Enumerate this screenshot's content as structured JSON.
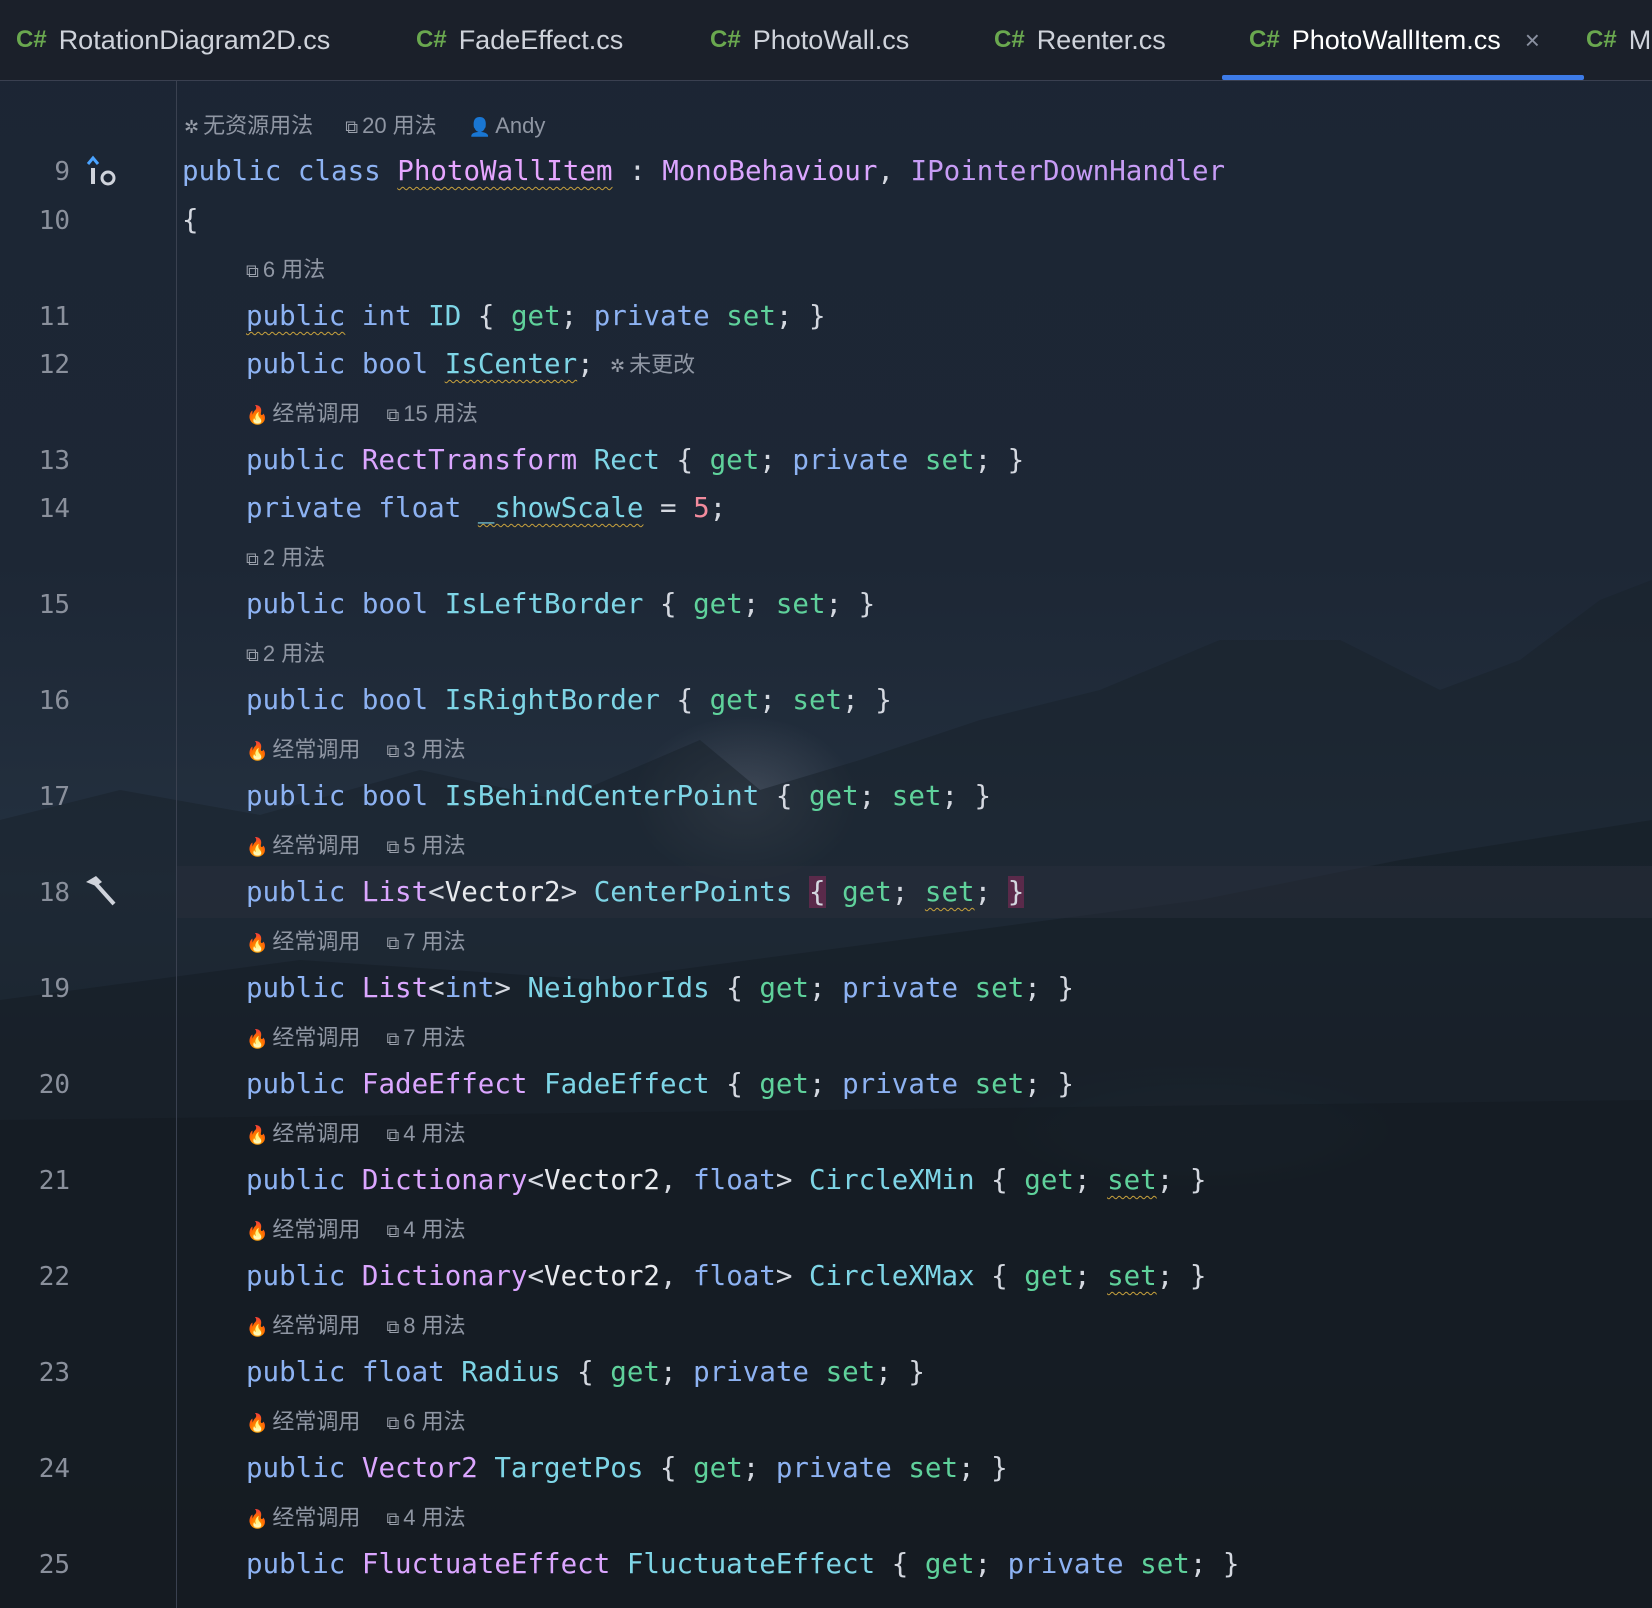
{
  "tabs": [
    {
      "lang": "C#",
      "label": "RotationDiagram2D.cs"
    },
    {
      "lang": "C#",
      "label": "FadeEffect.cs"
    },
    {
      "lang": "C#",
      "label": "PhotoWall.cs"
    },
    {
      "lang": "C#",
      "label": "Reenter.cs"
    },
    {
      "lang": "C#",
      "label": "PhotoWallItem.cs",
      "active": true,
      "close": "×"
    },
    {
      "lang": "C#",
      "label": "Ma"
    }
  ],
  "colors": {
    "accent": "#3d7be8",
    "keyword": "#8db2f2",
    "type": "#dba6ff",
    "accessor": "#5fd19b",
    "identifier": "#7ed5e6",
    "number": "#f28b9d"
  },
  "gutter": {
    "line_numbers": [
      "9",
      "10",
      "11",
      "12",
      "13",
      "14",
      "15",
      "16",
      "17",
      "18",
      "19",
      "20",
      "21",
      "22",
      "23",
      "24",
      "25"
    ],
    "icons": {
      "line9": "implements-icon",
      "line18": "hammer-icon"
    }
  },
  "hints": {
    "class_header": {
      "no_resource": "无资源用法",
      "usages": "20 用法",
      "author": "Andy"
    },
    "h11": {
      "usages": "6 用法"
    },
    "h12_inline": "未更改",
    "h13": {
      "frequent": "经常调用",
      "usages": "15 用法"
    },
    "h15": {
      "usages": "2 用法"
    },
    "h16": {
      "usages": "2 用法"
    },
    "h17": {
      "frequent": "经常调用",
      "usages": "3 用法"
    },
    "h18": {
      "frequent": "经常调用",
      "usages": "5 用法"
    },
    "h19": {
      "frequent": "经常调用",
      "usages": "7 用法"
    },
    "h20": {
      "frequent": "经常调用",
      "usages": "7 用法"
    },
    "h21": {
      "frequent": "经常调用",
      "usages": "4 用法"
    },
    "h22": {
      "frequent": "经常调用",
      "usages": "4 用法"
    },
    "h23": {
      "frequent": "经常调用",
      "usages": "8 用法"
    },
    "h24": {
      "frequent": "经常调用",
      "usages": "6 用法"
    },
    "h25": {
      "frequent": "经常调用",
      "usages": "4 用法"
    }
  },
  "code": {
    "l9": {
      "kw1": "public",
      "kw2": "class",
      "name": "PhotoWallItem",
      "colon": ":",
      "base": "MonoBehaviour",
      "comma": ",",
      "iface": "IPointerDownHandler"
    },
    "l10": "{",
    "l11": {
      "kw": "public",
      "type": "int",
      "name": "ID",
      "rest_open": "{",
      "get": "get",
      "semi1": ";",
      "priv": "private",
      "set": "set",
      "rest_close": "; }"
    },
    "l12": {
      "kw": "public",
      "type": "bool",
      "name": "IsCenter",
      "semi": ";"
    },
    "l13": {
      "kw": "public",
      "type": "RectTransform",
      "name": "Rect",
      "open": "{",
      "get": "get",
      "semi1": ";",
      "priv": "private",
      "set": "set",
      "close": "; }"
    },
    "l14": {
      "kw": "private",
      "type": "float",
      "name": "_showScale",
      "eq": "=",
      "num": "5",
      "semi": ";"
    },
    "l15": {
      "kw": "public",
      "type": "bool",
      "name": "IsLeftBorder",
      "open": "{",
      "get": "get",
      "semi1": ";",
      "set": "set",
      "close": "; }"
    },
    "l16": {
      "kw": "public",
      "type": "bool",
      "name": "IsRightBorder",
      "open": "{",
      "get": "get",
      "semi1": ";",
      "set": "set",
      "close": "; }"
    },
    "l17": {
      "kw": "public",
      "type": "bool",
      "name": "IsBehindCenterPoint",
      "open": "{",
      "get": "get",
      "semi1": ";",
      "set": "set",
      "close": "; }"
    },
    "l18": {
      "kw": "public",
      "generic": "List",
      "lt": "<",
      "arg": "Vector2",
      "gt": ">",
      "name": "CenterPoints",
      "open": "{",
      "get": "get",
      "semi1": ";",
      "set": "set",
      "semi2": ";",
      "close": "}"
    },
    "l19": {
      "kw": "public",
      "generic": "List",
      "lt": "<",
      "arg": "int",
      "gt": ">",
      "name": "NeighborIds",
      "open": "{",
      "get": "get",
      "semi1": ";",
      "priv": "private",
      "set": "set",
      "close": "; }"
    },
    "l20": {
      "kw": "public",
      "type": "FadeEffect",
      "name": "FadeEffect",
      "open": "{",
      "get": "get",
      "semi1": ";",
      "priv": "private",
      "set": "set",
      "close": "; }"
    },
    "l21": {
      "kw": "public",
      "generic": "Dictionary",
      "lt": "<",
      "arg": "Vector2",
      "comma": ",",
      "arg2": "float",
      "gt": ">",
      "name": "CircleXMin",
      "open": "{",
      "get": "get",
      "semi1": ";",
      "set": "set",
      "close": "; }"
    },
    "l22": {
      "kw": "public",
      "generic": "Dictionary",
      "lt": "<",
      "arg": "Vector2",
      "comma": ",",
      "arg2": "float",
      "gt": ">",
      "name": "CircleXMax",
      "open": "{",
      "get": "get",
      "semi1": ";",
      "set": "set",
      "close": "; }"
    },
    "l23": {
      "kw": "public",
      "type": "float",
      "name": "Radius",
      "open": "{",
      "get": "get",
      "semi1": ";",
      "priv": "private",
      "set": "set",
      "close": "; }"
    },
    "l24": {
      "kw": "public",
      "type": "Vector2",
      "name": "TargetPos",
      "open": "{",
      "get": "get",
      "semi1": ";",
      "priv": "private",
      "set": "set",
      "close": "; }"
    },
    "l25": {
      "kw": "public",
      "type": "FluctuateEffect",
      "name": "FluctuateEffect",
      "open": "{",
      "get": "get",
      "semi1": ";",
      "priv": "private",
      "set": "set",
      "close": "; }"
    }
  }
}
